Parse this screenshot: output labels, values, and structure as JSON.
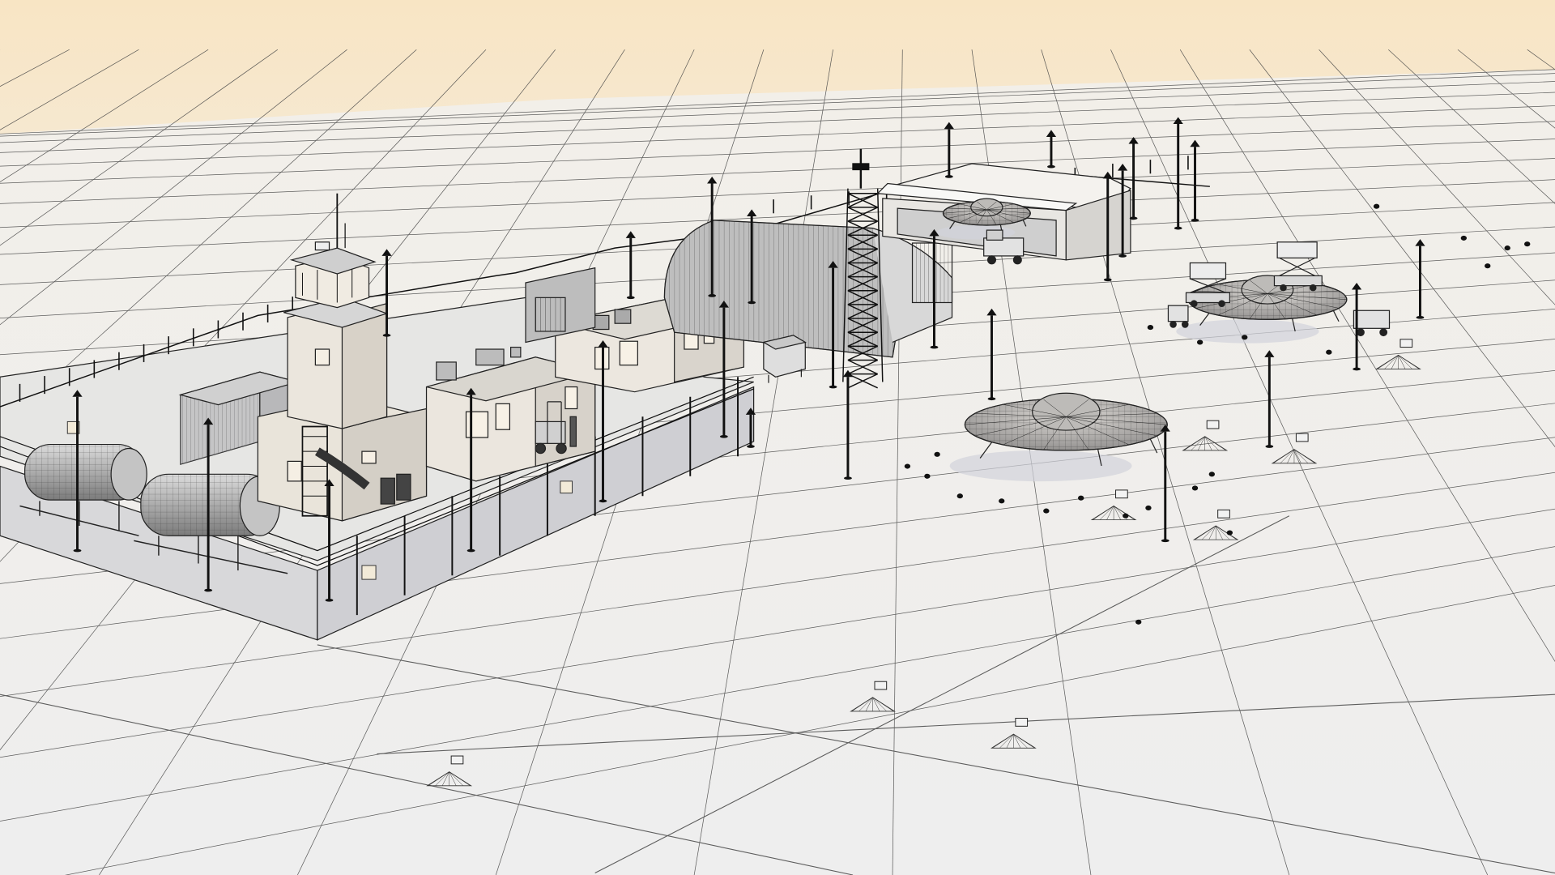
{
  "viewport": {
    "view_mode": "wireframe-on-shaded",
    "sky_color": "#f7e6c8",
    "ground_color": "#f1f1ef",
    "line_color": "#222222",
    "shadow_color": "#d5d6e0"
  },
  "scene_objects": [
    {
      "name": "ground-grid",
      "type": "grid"
    },
    {
      "name": "perimeter-fence",
      "type": "fence"
    },
    {
      "name": "control-tower",
      "type": "building"
    },
    {
      "name": "office-building-1",
      "type": "building"
    },
    {
      "name": "office-building-2",
      "type": "building"
    },
    {
      "name": "shipping-container",
      "type": "container"
    },
    {
      "name": "fuel-tank-1",
      "type": "tank"
    },
    {
      "name": "fuel-tank-2",
      "type": "tank"
    },
    {
      "name": "quonset-hangar",
      "type": "hangar"
    },
    {
      "name": "large-hangar",
      "type": "hangar"
    },
    {
      "name": "lattice-radio-tower",
      "type": "tower"
    },
    {
      "name": "ufo-saucer-front",
      "type": "aircraft"
    },
    {
      "name": "ufo-saucer-right",
      "type": "aircraft"
    },
    {
      "name": "ufo-saucer-hangar",
      "type": "aircraft"
    },
    {
      "name": "forklift",
      "type": "vehicle"
    },
    {
      "name": "scissor-lift-truck-1",
      "type": "vehicle"
    },
    {
      "name": "scissor-lift-truck-2",
      "type": "vehicle"
    },
    {
      "name": "ground-cart",
      "type": "vehicle"
    },
    {
      "name": "utility-cart",
      "type": "vehicle"
    },
    {
      "name": "portable-generator",
      "type": "equipment"
    },
    {
      "name": "street-lamps",
      "type": "lighting"
    },
    {
      "name": "floodlight-pads",
      "type": "lighting"
    },
    {
      "name": "ground-bollards",
      "type": "marker"
    }
  ]
}
